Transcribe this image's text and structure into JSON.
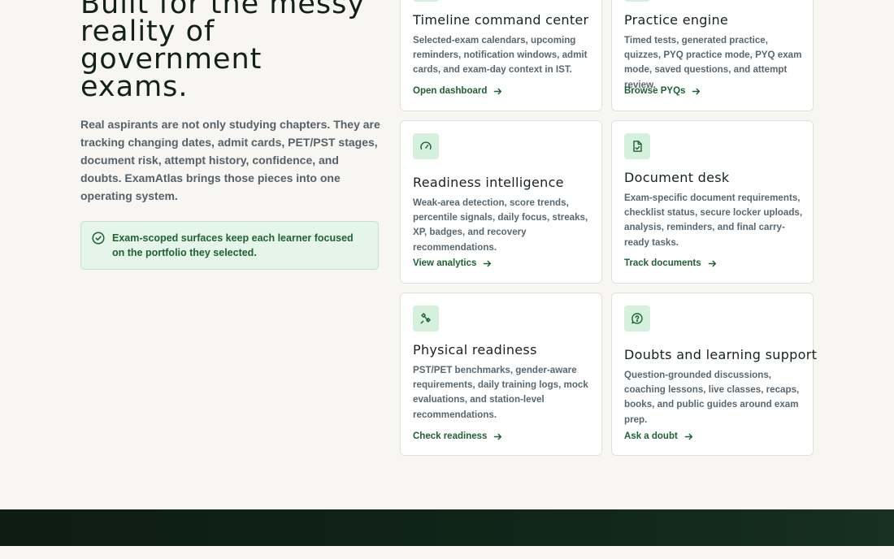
{
  "hero": {
    "headline_lines": [
      "Built for the messy",
      "reality of government",
      "exams."
    ],
    "intro": "Real aspirants are not only studying chapters. They are tracking changing dates, admit cards, PET/PST stages, document risk, attempt history, confidence, and doubts. ExamAtlas brings those pieces into one operating system.",
    "callout": "Exam-scoped surfaces keep each learner focused on the portfolio they selected.",
    "callout_icon": "check-circle-icon"
  },
  "cards": [
    {
      "title": "Timeline command center",
      "desc": "Selected-exam calendars, upcoming reminders, notification windows, admit cards, and exam-day context in IST.",
      "link": "Open dashboard",
      "icon": "calendar-icon"
    },
    {
      "title": "Practice engine",
      "desc": "Timed tests, generated practice, quizzes, PYQ practice mode, PYQ exam mode, saved questions, and attempt review.",
      "link": "Browse PYQs",
      "icon": "book-icon"
    },
    {
      "title": "Readiness intelligence",
      "desc": "Weak-area detection, score trends, percentile signals, daily focus, streaks, XP, badges, and recovery recommendations.",
      "link": "View analytics",
      "icon": "gauge-icon"
    },
    {
      "title": "Document desk",
      "desc": "Exam-specific document requirements, checklist status, secure locker uploads, analysis, reminders, and final carry-ready tasks.",
      "link": "Track documents",
      "icon": "file-check-icon"
    },
    {
      "title": "Physical readiness",
      "desc": "PST/PET benchmarks, gender-aware requirements, daily training logs, mock evaluations, and station-level recommendations.",
      "link": "Check readiness",
      "icon": "dumbbell-icon"
    },
    {
      "title": "Doubts and learning support",
      "desc": "Question-grounded discussions, coaching lessons, live classes, recaps, books, and public guides around exam prep.",
      "link": "Ask a doubt",
      "icon": "message-question-icon"
    }
  ],
  "colors": {
    "accent": "#1f6133",
    "icon_bg": "#d5f0dc",
    "page_bg": "#f7f6f2",
    "footer_bg": "#0d1c14"
  }
}
